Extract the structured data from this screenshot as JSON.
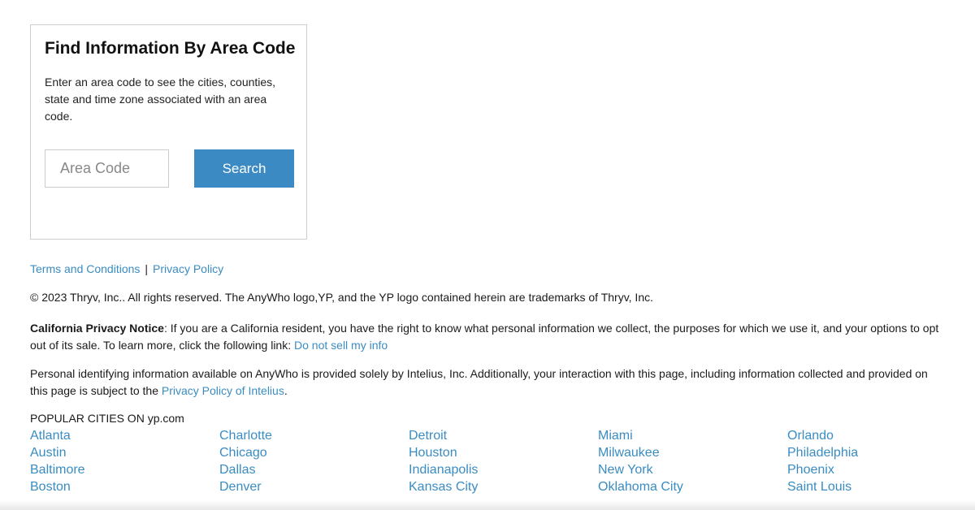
{
  "area_search": {
    "title": "Find Information By Area Code",
    "description": "Enter an area code to see the cities, counties, state and time zone associated with an area code.",
    "input_placeholder": "Area Code",
    "input_value": "",
    "search_label": "Search"
  },
  "footer": {
    "terms_label": "Terms and Conditions",
    "separator": "|",
    "privacy_label": "Privacy Policy",
    "copyright": "© 2023 Thryv, Inc.. All rights reserved. The AnyWho logo,YP, and the YP logo contained herein are trademarks of Thryv, Inc.",
    "ca_notice": {
      "heading": "California Privacy Notice",
      "text": ": If you are a California resident, you have the right to know what personal information we collect, the purposes for which we use it, and your options to opt out of its sale. To learn more, click the following link: ",
      "link_label": "Do not sell my info"
    },
    "pii_notice": {
      "text": "Personal identifying information available on AnyWho is provided solely by Intelius, Inc. Additionally, your interaction with this page, including information collected and provided on this page is subject to the ",
      "link_label": "Privacy Policy of Intelius",
      "suffix": "."
    }
  },
  "popular_cities": {
    "title": "POPULAR CITIES ON yp.com",
    "columns": [
      [
        "Atlanta",
        "Austin",
        "Baltimore",
        "Boston"
      ],
      [
        "Charlotte",
        "Chicago",
        "Dallas",
        "Denver"
      ],
      [
        "Detroit",
        "Houston",
        "Indianapolis",
        "Kansas City"
      ],
      [
        "Miami",
        "Milwaukee",
        "New York",
        "Oklahoma City"
      ],
      [
        "Orlando",
        "Philadelphia",
        "Phoenix",
        "Saint Louis"
      ]
    ]
  },
  "colors": {
    "link": "#3a8cc2",
    "button": "#3b8ac4",
    "box_border": "#cfcfcf"
  }
}
